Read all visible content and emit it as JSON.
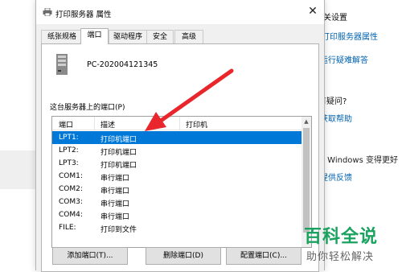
{
  "background_page": {
    "related_heading": "相关设置",
    "print_server_link": "打印服务器属性",
    "troubleshoot_link": "运行疑难解答",
    "question_heading": "有疑问?",
    "help_link": "获取帮助",
    "windows_text": "让 Windows 变得更好",
    "feedback_link": "提供反馈"
  },
  "dialog": {
    "title": "打印服务器 属性",
    "close_glyph": "✕",
    "tabs": [
      {
        "label": "纸张规格",
        "active": false
      },
      {
        "label": "端口",
        "active": true
      },
      {
        "label": "驱动程序",
        "active": false
      },
      {
        "label": "安全",
        "active": false
      },
      {
        "label": "高级",
        "active": false
      }
    ],
    "server_name": "PC-202004121345",
    "ports_label": "这台服务器上的端口(P)",
    "columns": {
      "port": "端口",
      "description": "描述",
      "printer": "打印机"
    },
    "ports": [
      {
        "port": "LPT1:",
        "description": "打印机端口",
        "printer": "",
        "selected": true
      },
      {
        "port": "LPT2:",
        "description": "打印机端口",
        "printer": "",
        "selected": false
      },
      {
        "port": "LPT3:",
        "description": "打印机端口",
        "printer": "",
        "selected": false
      },
      {
        "port": "COM1:",
        "description": "串行端口",
        "printer": "",
        "selected": false
      },
      {
        "port": "COM2:",
        "description": "串行端口",
        "printer": "",
        "selected": false
      },
      {
        "port": "COM3:",
        "description": "串行端口",
        "printer": "",
        "selected": false
      },
      {
        "port": "COM4:",
        "description": "串行端口",
        "printer": "",
        "selected": false
      },
      {
        "port": "FILE:",
        "description": "打印到文件",
        "printer": "",
        "selected": false
      }
    ],
    "buttons": {
      "add": "添加端口(T)...",
      "delete": "删除端口(D)",
      "configure": "配置端口(C)..."
    }
  },
  "annotation": {
    "arrow_color": "#e8262b"
  },
  "watermark": {
    "title": "百科全说",
    "subtitle": "助你轻松解决",
    "color": "#1aa260"
  },
  "colors": {
    "selection": "#0078d7",
    "link": "#0063b1"
  }
}
